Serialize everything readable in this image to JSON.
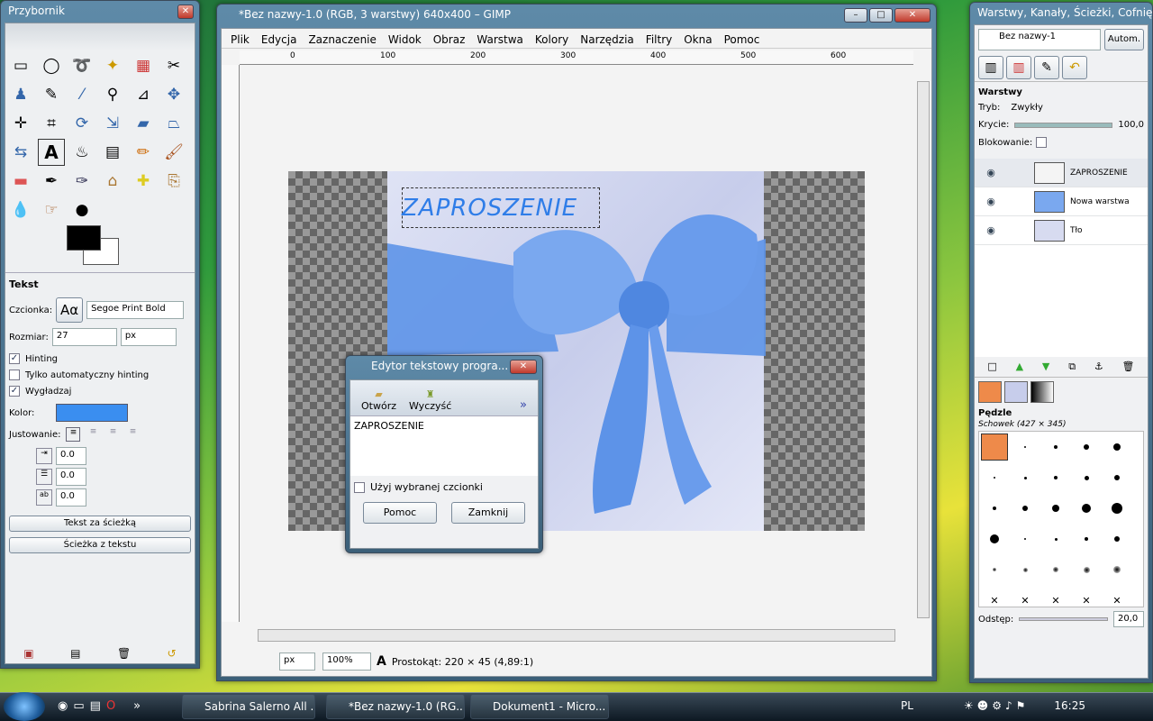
{
  "toolbox": {
    "title": "Przybornik",
    "section_title": "Tekst",
    "font_label": "Czcionka:",
    "font_preview": "Aα",
    "font_value": "Segoe Print Bold",
    "size_label": "Rozmiar:",
    "size_value": "27",
    "size_unit": "px",
    "hinting_label": "Hinting",
    "autohint_label": "Tylko automatyczny hinting",
    "antialias_label": "Wygładzaj",
    "color_label": "Kolor:",
    "justify_label": "Justowanie:",
    "indent_value": "0.0",
    "line_spacing_value": "0.0",
    "letter_spacing_value": "0.0",
    "btn_text_along_path": "Tekst za ścieżką",
    "btn_path_from_text": "Ścieżka z tekstu",
    "text_color": "#3a8ef0"
  },
  "gimp": {
    "title": "*Bez nazwy-1.0 (RGB, 3 warstwy) 640x400 – GIMP",
    "menu": [
      "Plik",
      "Edycja",
      "Zaznaczenie",
      "Widok",
      "Obraz",
      "Warstwa",
      "Kolory",
      "Narzędzia",
      "Filtry",
      "Okna",
      "Pomoc"
    ],
    "ruler_ticks": [
      "0",
      "100",
      "200",
      "300",
      "400",
      "500",
      "600"
    ],
    "canvas_text": "ZAPROSZENIE",
    "unit": "px",
    "zoom": "100%",
    "status": "Prostokąt: 220 × 45  (4,89:1)"
  },
  "text_editor": {
    "title": "Edytor tekstowy progra...",
    "open_label": "Otwórz",
    "clear_label": "Wyczyść",
    "more_label": "»",
    "content": "ZAPROSZENIE",
    "use_font_label": "Użyj wybranej czcionki",
    "help_label": "Pomoc",
    "close_label": "Zamknij"
  },
  "layers": {
    "title": "Warstwy, Kanały, Ścieżki, Cofnięc...",
    "image_select": "Bez nazwy-1",
    "auto_label": "Autom.",
    "panel_title": "Warstwy",
    "mode_label": "Tryb:",
    "mode_value": "Zwykły",
    "opacity_label": "Krycie:",
    "opacity_value": "100,0",
    "opacity_fraction": 1.0,
    "lock_label": "Blokowanie:",
    "items": [
      {
        "name": "ZAPROSZENIE"
      },
      {
        "name": "Nowa warstwa"
      },
      {
        "name": "Tło"
      }
    ]
  },
  "brushes": {
    "title": "Pędzle",
    "current": "Schowek (427 × 345)",
    "spacing_label": "Odstęp:",
    "spacing_value": "20,0"
  },
  "taskbar": {
    "items": [
      "Sabrina Salerno All ...",
      "*Bez nazwy-1.0 (RG...",
      "Dokument1 - Micro..."
    ],
    "lang": "PL",
    "clock": "16:25"
  }
}
